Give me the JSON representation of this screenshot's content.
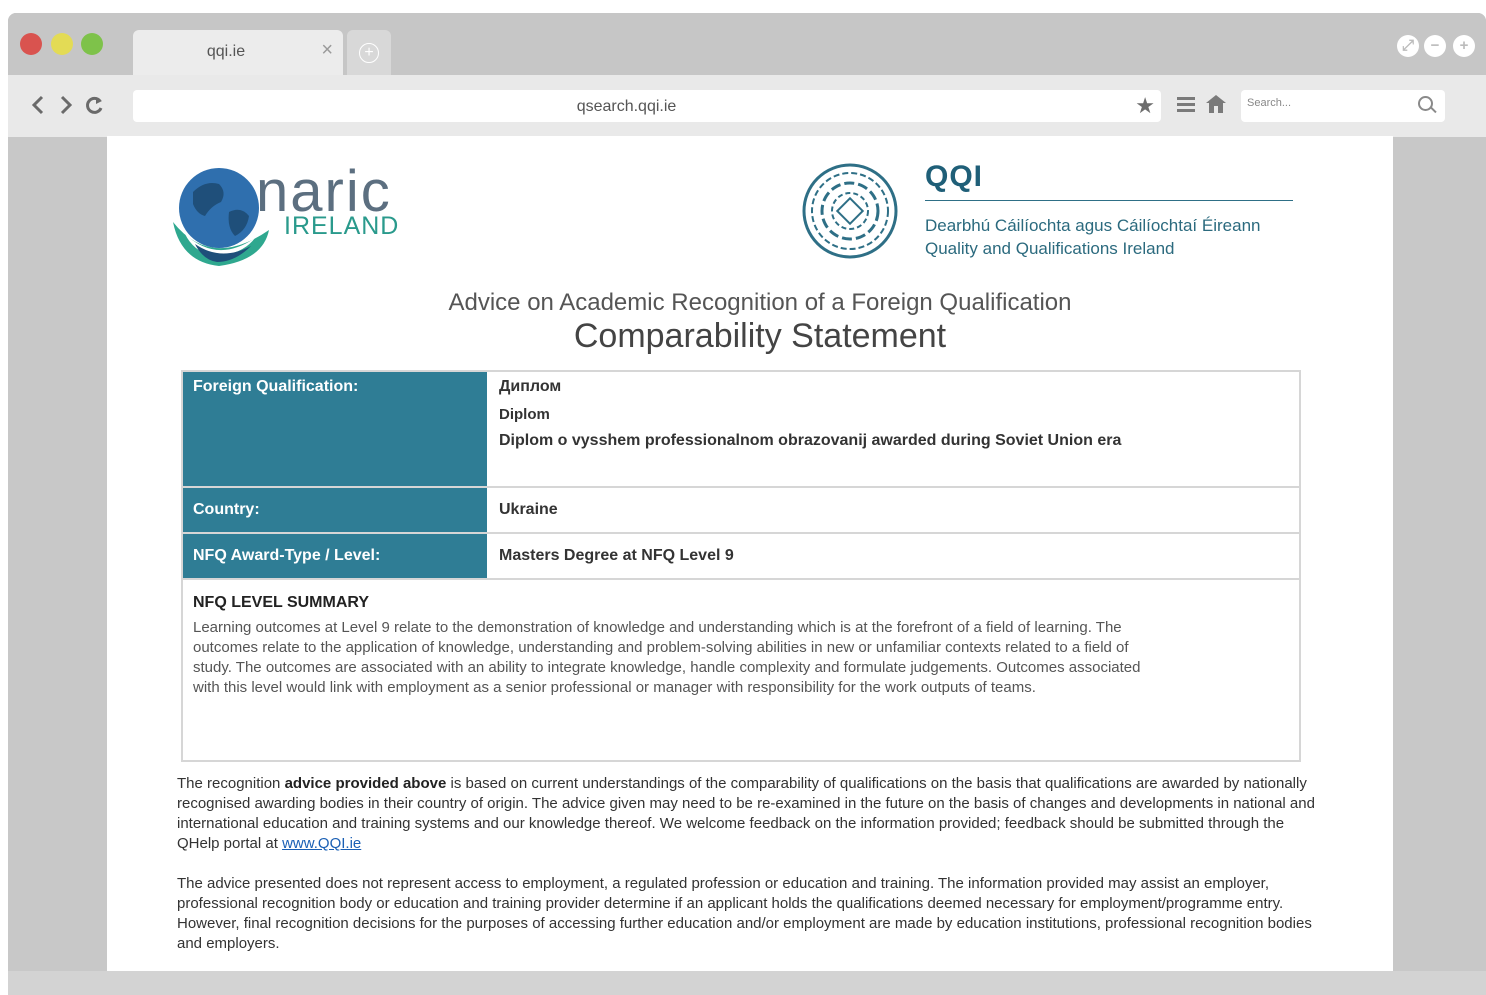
{
  "browser": {
    "tab_title": "qqi.ie",
    "url": "qsearch.qqi.ie",
    "search_placeholder": "Search..."
  },
  "header": {
    "naric_logo_text": "naric",
    "naric_logo_subtext": "IRELAND",
    "qqi_logo_text": "QQI",
    "qqi_irish": "Dearbhú Cáilíochta agus Cáilíochtaí Éireann",
    "qqi_english": "Quality and Qualifications Ireland"
  },
  "document": {
    "heading": "Advice on Academic Recognition of a Foreign Qualification",
    "subheading": "Comparability Statement",
    "table": {
      "foreign_qualification_label": "Foreign Qualification:",
      "foreign_qualification_values": [
        "Диплом",
        "Diplom",
        "Diplom o vysshem professionalnom obrazovanij awarded during Soviet Union era"
      ],
      "country_label": "Country:",
      "country_value": "Ukraine",
      "nfq_label": "NFQ Award-Type / Level:",
      "nfq_value": "Masters Degree at NFQ Level 9",
      "summary_title": "NFQ LEVEL SUMMARY",
      "summary_lines": [
        "Learning outcomes at Level 9 relate to the demonstration of knowledge and understanding which is at the forefront of a field of learning. The",
        "outcomes relate to the application of knowledge, understanding and problem-solving abilities in new or unfamiliar contexts related to a field of",
        "study. The outcomes are associated with an ability to integrate knowledge, handle complexity and formulate judgements. Outcomes associated",
        "with this level would link with employment as a senior professional or manager with responsibility for the work outputs of teams."
      ]
    },
    "para1_lead": "The recognition ",
    "para1_bold": "advice provided above",
    "para1_rest": " is based on current understandings of the comparability of qualifications on the basis that qualifications are awarded by nationally recognised awarding bodies in their country of origin. The advice given may need to be re-examined in the future on the basis of changes and developments in national and international education and training systems and our knowledge thereof. We welcome feedback on the information provided; feedback should be submitted through the QHelp portal at ",
    "para1_link": "www.QQI.ie",
    "para2": "The advice presented does not represent access to employment, a regulated profession or education and training. The information provided may assist an employer, professional recognition body or education and training provider determine if an applicant holds the qualifications deemed necessary for employment/programme entry. However, final recognition decisions for the purposes of accessing further education and/or employment are made by education institutions, professional recognition bodies and employers."
  },
  "colors": {
    "table_header": "#2f7d95",
    "qqi_brand": "#1f5f78",
    "naric_teal": "#2a9a8c"
  },
  "icons": [
    "close-icon",
    "plus-icon",
    "back-arrow-icon",
    "forward-arrow-icon",
    "refresh-icon",
    "star-icon",
    "menu-icon",
    "home-icon",
    "search-icon",
    "globe-icon",
    "spiral-emblem-icon"
  ]
}
